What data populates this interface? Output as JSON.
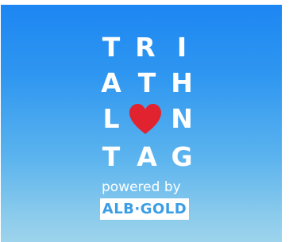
{
  "logo": {
    "rows": [
      [
        "T",
        "R",
        "I"
      ],
      [
        "A",
        "T",
        "H"
      ],
      [
        "L",
        "",
        "N"
      ],
      [
        "T",
        "A",
        "G"
      ]
    ],
    "heart_color": "#e0232f",
    "heart_icon": "heart-icon",
    "powered_by": "powered by",
    "brand": "ALB·GOLD"
  },
  "colors": {
    "sky_top": "#1d86f2",
    "sky_bottom": "#9dd3ec",
    "text": "#ffffff",
    "brand_text": "#3a9de6"
  }
}
